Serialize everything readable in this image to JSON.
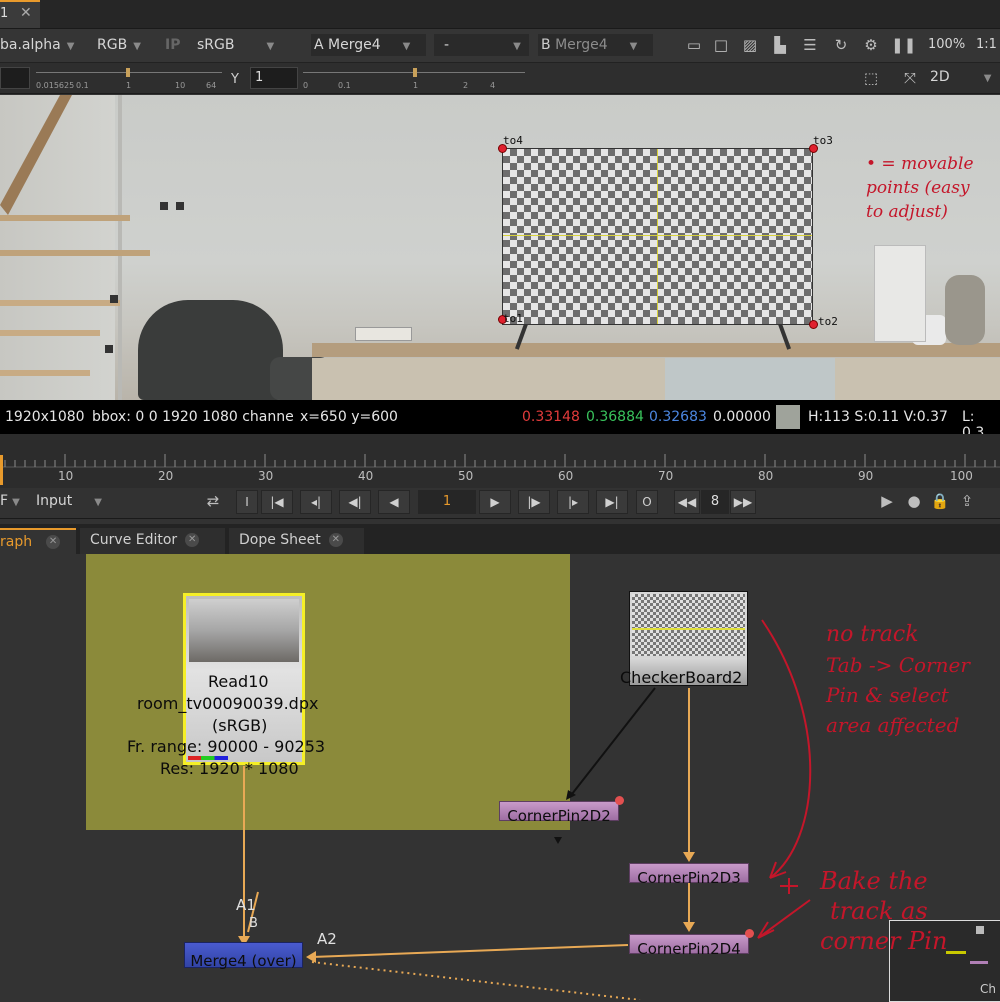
{
  "top_tab": {
    "label": "1"
  },
  "toolbar": {
    "channels": "ba.alpha",
    "color": "RGB",
    "ip": "IP",
    "lut": "sRGB",
    "a_label": "A",
    "a_input": "Merge4",
    "compare": "-",
    "b_label": "B",
    "b_input": "Merge4",
    "zoom": "100%",
    "ratio": "1:1"
  },
  "toolbar2": {
    "gain_ticks": [
      "0.015625",
      "0.1",
      "1",
      "10",
      "64"
    ],
    "y_label": "Y",
    "y_value": "1",
    "gamma_ticks": [
      "0",
      "0.1",
      "1",
      "2",
      "4"
    ],
    "view_mode": "2D"
  },
  "viewer": {
    "points": [
      "to1",
      "to2",
      "to3",
      "to4"
    ],
    "annotation": [
      "• = movable",
      "points (easy",
      "to adjust)"
    ]
  },
  "infobar": {
    "resolution": "1920x1080",
    "bbox": "bbox: 0 0 1920 1080 channe",
    "coords": "x=650 y=600",
    "r": "0.33148",
    "g": "0.36884",
    "b": "0.32683",
    "a": "0.00000",
    "swatch": "#9fa39b",
    "hsv": "H:113 S:0.11 V:0.37",
    "l": "L: 0.3"
  },
  "timeline": {
    "ticks": [
      "10",
      "20",
      "30",
      "40",
      "50",
      "60",
      "70",
      "80",
      "90",
      "100"
    ]
  },
  "playback": {
    "fps_label": "F",
    "input": "Input",
    "frame": "1",
    "step": "8"
  },
  "panel_tabs": [
    "raph",
    "Curve Editor",
    "Dope Sheet"
  ],
  "graph": {
    "read_node": {
      "name": "Read10",
      "file": "room_tv00090039.dpx",
      "cs": "(sRGB)",
      "range": "Fr. range: 90000 - 90253",
      "res": "Res: 1920 * 1080"
    },
    "checker_node": "CheckerBoard2",
    "cornerpin2": "CornerPin2D2",
    "cornerpin3": "CornerPin2D3",
    "cornerpin4": "CornerPin2D4",
    "merge": "Merge4 (over)",
    "label_a1": "A1",
    "label_b": "B",
    "label_a2": "A2",
    "corner_node": "Ch",
    "notes1": [
      "no track",
      "Tab -> Corner",
      "Pin & select",
      "area affected"
    ],
    "notes2": [
      "Bake the",
      "track as",
      "corner Pin"
    ]
  },
  "colors": {
    "accent": "#e89a2c",
    "merge": "#3e4fb5",
    "cornerpin": "#b07fb5",
    "backdrop": "#8b8a3a",
    "handwriting": "#c4162a"
  }
}
